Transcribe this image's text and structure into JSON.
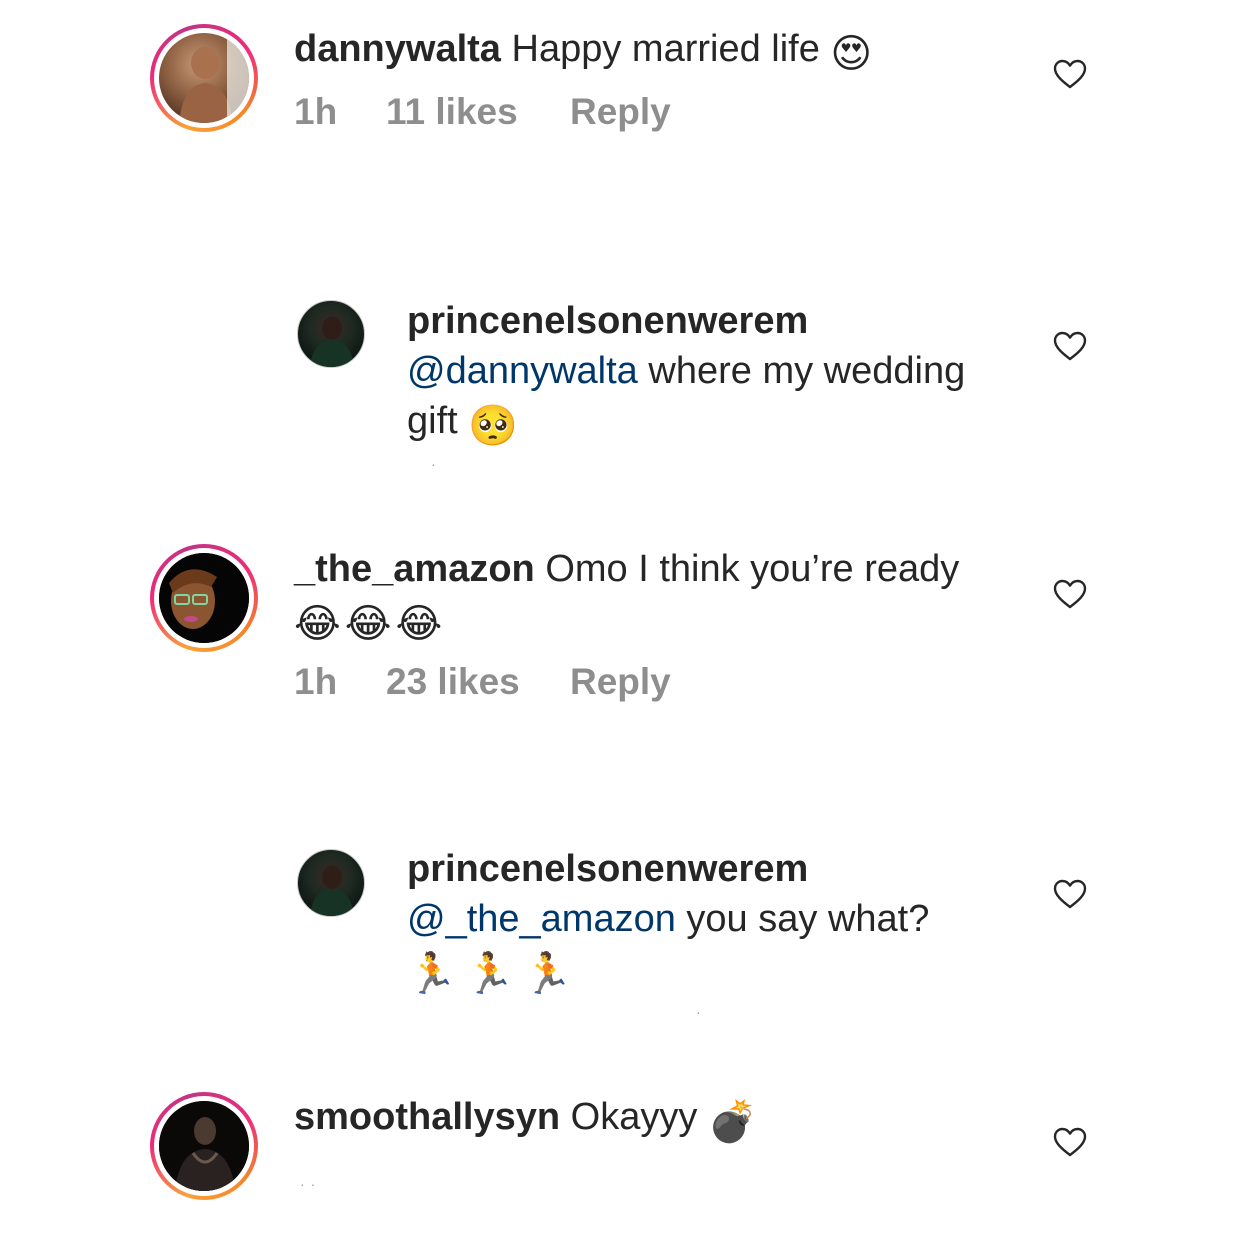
{
  "comments": [
    {
      "username": "dannywalta",
      "text": "Happy married life",
      "emoji": "😍",
      "time": "1h",
      "likes": "11 likes",
      "reply": "Reply"
    },
    {
      "username": "princenelsonenwerem",
      "mention": "@dannywalta",
      "text_a": "where my wedding",
      "text_b": "gift",
      "emoji": "🥺"
    },
    {
      "username": "_the_amazon",
      "text": "Omo I think you’re ready",
      "emoji": "😂😂😂",
      "time": "1h",
      "likes": "23 likes",
      "reply": "Reply"
    },
    {
      "username": "princenelsonenwerem",
      "mention": "@_the_amazon",
      "text": "you say what?",
      "emoji": "🏃🏃🏃"
    },
    {
      "username": "smoothallysyn",
      "text": "Okayyy",
      "emoji": "💣"
    }
  ],
  "icons": {
    "like": "heart-outline-icon",
    "avatar_ring_colors": [
      "#f9a13a",
      "#ee2a7b",
      "#c13584"
    ],
    "mention_color": "#00376b",
    "meta_color": "#8e8e8e"
  }
}
